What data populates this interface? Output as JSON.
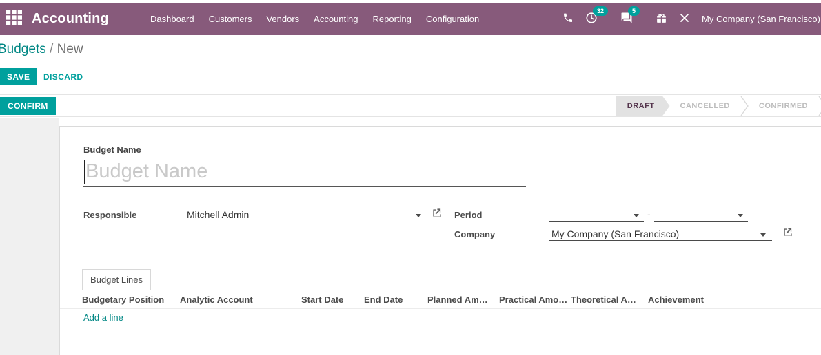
{
  "colors": {
    "brand_purple": "#875A7B",
    "accent_teal": "#00A09D",
    "link_teal": "#008784"
  },
  "nav": {
    "app_name": "Accounting",
    "menu": [
      "Dashboard",
      "Customers",
      "Vendors",
      "Accounting",
      "Reporting",
      "Configuration"
    ],
    "activity_count": "32",
    "message_count": "5",
    "company": "My Company (San Francisco)",
    "icons": [
      "apps-grid",
      "phone",
      "activity-clock",
      "messages",
      "gift",
      "tools"
    ]
  },
  "breadcrumb": {
    "root": "Budgets",
    "separator": "/",
    "current": "New"
  },
  "toolbar": {
    "save": "SAVE",
    "discard": "DISCARD",
    "confirm": "CONFIRM"
  },
  "statusbar": {
    "states": [
      "DRAFT",
      "CANCELLED",
      "CONFIRMED"
    ],
    "active": "DRAFT"
  },
  "form": {
    "budget_name": {
      "label": "Budget Name",
      "placeholder": "Budget Name",
      "value": ""
    },
    "responsible": {
      "label": "Responsible",
      "value": "Mitchell Admin"
    },
    "period": {
      "label": "Period",
      "start_value": "",
      "end_value": "",
      "separator": "-"
    },
    "company": {
      "label": "Company",
      "value": "My Company (San Francisco)"
    }
  },
  "notebook": {
    "tabs": [
      "Budget Lines"
    ],
    "active_tab": "Budget Lines"
  },
  "budget_lines": {
    "headers": [
      "Budgetary Position",
      "Analytic Account",
      "Start Date",
      "End Date",
      "Planned Am…",
      "Practical Amo…",
      "Theoretical A…",
      "Achievement"
    ],
    "rows": [],
    "add_line_label": "Add a line"
  }
}
